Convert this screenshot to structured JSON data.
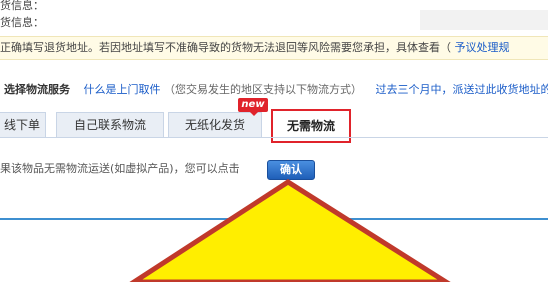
{
  "header": {
    "row1_label": "货信息：",
    "row2_label": "货信息："
  },
  "notice": {
    "text": "正确填写退货地址。若因地址填写不准确导致的货物无法退回等风险需要您承担，具体查看（",
    "help_link": "予议处理规"
  },
  "service": {
    "title": "选择物流服务",
    "pickup_link": "什么是上门取件",
    "note": "（您交易发生的地区支持以下物流方式）",
    "extra_link": "过去三个月中，派送过此收货地址的物"
  },
  "tabs": [
    {
      "label": "线下单",
      "active": false
    },
    {
      "label": "自己联系物流",
      "active": false
    },
    {
      "label": "无纸化发货",
      "active": false
    },
    {
      "label": "无需物流",
      "active": true
    }
  ],
  "badge": {
    "text": "new"
  },
  "body": {
    "description": "果该物品无需物流运送(如虚拟产品)，您可以点击",
    "confirm_label": "确认"
  },
  "colors": {
    "accent_red": "#e0232b",
    "arrow_fill": "#ffee00",
    "arrow_stroke": "#c0392b",
    "link_blue": "#1a5cc8"
  }
}
